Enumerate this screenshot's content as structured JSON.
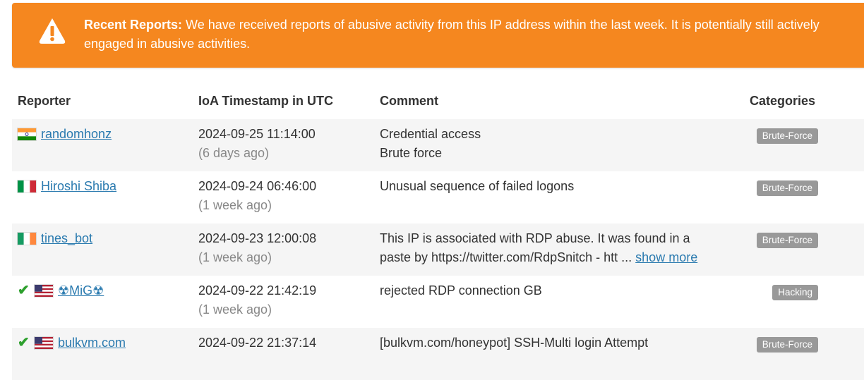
{
  "alert": {
    "title": "Recent Reports:",
    "message": "We have received reports of abusive activity from this IP address within the last week. It is potentially still actively engaged in abusive activities."
  },
  "table": {
    "headers": {
      "reporter": "Reporter",
      "timestamp": "IoA Timestamp in UTC",
      "comment": "Comment",
      "categories": "Categories"
    },
    "rows": [
      {
        "verified": false,
        "flag": "india",
        "reporter": "randomhonz",
        "timestamp": "2024-09-25 11:14:00",
        "ago": "(6 days ago)",
        "comment_lines": [
          "Credential access",
          "Brute force"
        ],
        "category": "Brute-Force"
      },
      {
        "verified": false,
        "flag": "italy",
        "reporter": "Hiroshi Shiba",
        "timestamp": "2024-09-24 06:46:00",
        "ago": "(1 week ago)",
        "comment_lines": [
          "Unusual sequence of failed logons"
        ],
        "category": "Brute-Force"
      },
      {
        "verified": false,
        "flag": "ireland",
        "reporter": "tines_bot",
        "timestamp": "2024-09-23 12:00:08",
        "ago": "(1 week ago)",
        "comment_lines": [
          "This IP is associated with RDP abuse. It was found in a",
          "paste by https://twitter.com/RdpSnitch - htt ..."
        ],
        "show_more": "show more",
        "category": "Brute-Force"
      },
      {
        "verified": true,
        "flag": "usa",
        "reporter": "☢MiG☢",
        "timestamp": "2024-09-22 21:42:19",
        "ago": "(1 week ago)",
        "comment_lines": [
          "rejected RDP connection GB"
        ],
        "category": "Hacking"
      },
      {
        "verified": true,
        "flag": "usa",
        "reporter": "bulkvm.com",
        "timestamp": "2024-09-22 21:37:14",
        "ago": "",
        "comment_lines": [
          "[bulkvm.com/honeypot] SSH-Multi login Attempt"
        ],
        "category": "Brute-Force"
      }
    ]
  },
  "icons": {
    "alert": "warning-triangle-icon",
    "verified": "check-mark-icon"
  },
  "colors": {
    "alert_bg": "#f5871f",
    "link": "#2a7aaf",
    "badge_bg": "#999999",
    "check": "#2ea02e"
  }
}
